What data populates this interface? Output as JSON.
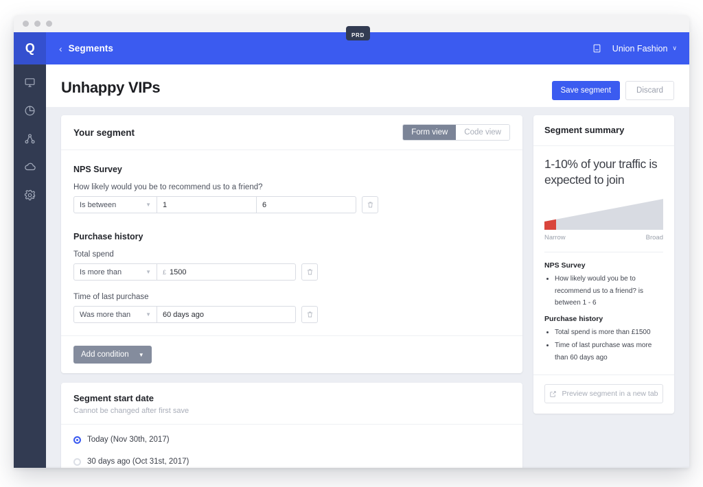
{
  "window": {
    "traffic_dots": [
      "close",
      "minimize",
      "zoom"
    ]
  },
  "rail": {
    "logo_label": "Q",
    "items": [
      {
        "icon": "monitor-icon",
        "name": "overview"
      },
      {
        "icon": "pie-chart-icon",
        "name": "analytics"
      },
      {
        "icon": "network-nodes-icon",
        "name": "segments"
      },
      {
        "icon": "cloud-icon",
        "name": "data"
      },
      {
        "icon": "gear-icon",
        "name": "settings"
      }
    ]
  },
  "topbar": {
    "back_chevron": "‹",
    "breadcrumb": "Segments",
    "env_badge": "PRD",
    "docs_icon": "book-icon",
    "account_name": "Union Fashion",
    "account_chevron": "∨",
    "bg_color": "#3b5bf0"
  },
  "page": {
    "title": "Unhappy VIPs",
    "save_label": "Save segment",
    "discard_label": "Discard",
    "accent_color": "#3b5bf0"
  },
  "segment_card": {
    "title": "Your segment",
    "view_toggle": {
      "options": [
        "Form view",
        "Code view"
      ],
      "selected": "Form view"
    },
    "groups": [
      {
        "title": "NPS Survey",
        "conditions": [
          {
            "label": "How likely would you be to recommend us to a friend?",
            "operator": "Is between",
            "value1": "1",
            "value2": "6",
            "delete_icon": "trash-icon"
          }
        ]
      },
      {
        "title": "Purchase history",
        "conditions": [
          {
            "label": "Total spend",
            "operator": "Is more than",
            "prefix": "£",
            "value1": "1500",
            "delete_icon": "trash-icon"
          },
          {
            "label": "Time of last purchase",
            "operator": "Was more than",
            "value1": "60 days ago",
            "delete_icon": "trash-icon"
          }
        ]
      }
    ],
    "add_condition_label": "Add condition",
    "add_condition_caret": "▼"
  },
  "start_date_card": {
    "title": "Segment start date",
    "subtitle": "Cannot be changed after first save",
    "options": [
      {
        "label": "Today (Nov 30th, 2017)",
        "selected": true
      },
      {
        "label": "30 days ago (Oct 31st, 2017)",
        "selected": false
      }
    ]
  },
  "summary": {
    "title": "Segment summary",
    "headline": "1-10% of your traffic is expected to join",
    "gauge": {
      "narrow_label": "Narrow",
      "broad_label": "Broad",
      "fill_color": "#d8dbe2",
      "active_color": "#d9453c",
      "active_fraction": 0.1
    },
    "groups": [
      {
        "title": "NPS Survey",
        "items": [
          "How likely would you be to recommend us to a friend? is between 1 - 6"
        ]
      },
      {
        "title": "Purchase history",
        "items": [
          "Total spend is more than £1500",
          "Time of last purchase was more than 60 days ago"
        ]
      }
    ],
    "preview_label": "Preview segment in a new tab",
    "preview_icon": "external-link-icon"
  }
}
